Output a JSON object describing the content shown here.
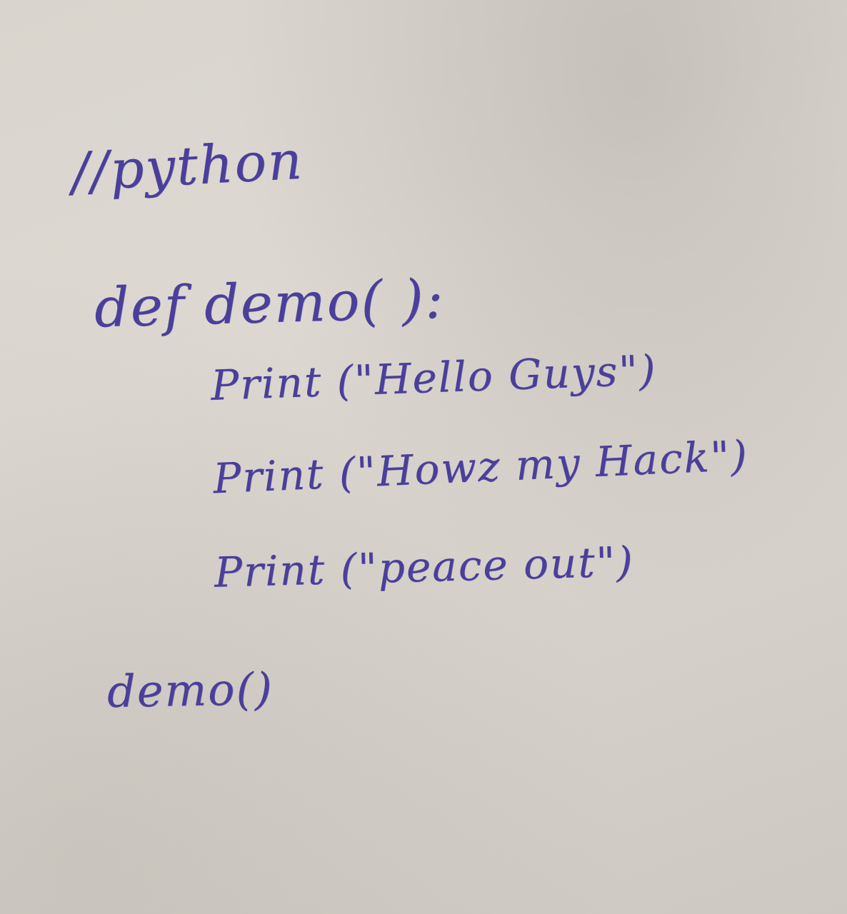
{
  "handwriting": {
    "comment": "//python",
    "def_line": "def demo( ):",
    "print_1": "Print (\"Hello Guys\")",
    "print_2": "Print (\"Howz my Hack\")",
    "print_3": "Print (\"peace out\")",
    "call": "demo()"
  },
  "colors": {
    "ink": "#4a3f9a",
    "paper": "#d9d5ce"
  }
}
